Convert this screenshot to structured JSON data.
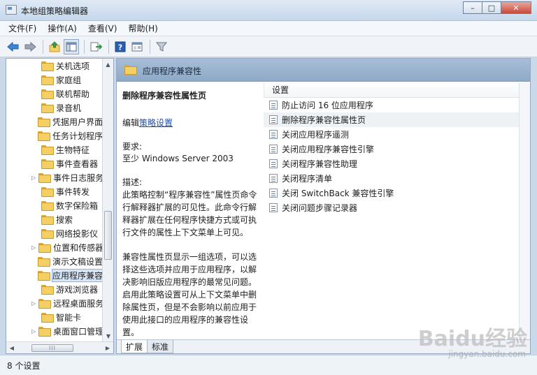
{
  "window": {
    "title": "本地组策略编辑器",
    "minimize": "–",
    "maximize": "□",
    "close": "✕"
  },
  "menu": {
    "file": "文件(F)",
    "action": "操作(A)",
    "view": "查看(V)",
    "help": "帮助(H)"
  },
  "toolbar": {
    "icons": [
      "back-arrow-icon",
      "forward-arrow-icon",
      "up-folder-icon",
      "show-hide-tree-icon",
      "export-list-icon",
      "help-icon",
      "extended-view-icon",
      "filter-icon"
    ]
  },
  "tree": {
    "items": [
      {
        "label": "关机选项",
        "expandable": false
      },
      {
        "label": "家庭组",
        "expandable": false
      },
      {
        "label": "联机帮助",
        "expandable": false
      },
      {
        "label": "录音机",
        "expandable": false
      },
      {
        "label": "凭据用户界面",
        "expandable": false
      },
      {
        "label": "任务计划程序",
        "expandable": false
      },
      {
        "label": "生物特征",
        "expandable": false
      },
      {
        "label": "事件查看器",
        "expandable": false
      },
      {
        "label": "事件日志服务",
        "expandable": true
      },
      {
        "label": "事件转发",
        "expandable": false
      },
      {
        "label": "数字保险箱",
        "expandable": false
      },
      {
        "label": "搜索",
        "expandable": false
      },
      {
        "label": "网络投影仪",
        "expandable": false
      },
      {
        "label": "位置和传感器",
        "expandable": true
      },
      {
        "label": "演示文稿设置",
        "expandable": false
      },
      {
        "label": "应用程序兼容",
        "expandable": false,
        "selected": true
      },
      {
        "label": "游戏浏览器",
        "expandable": false
      },
      {
        "label": "远程桌面服务",
        "expandable": true
      },
      {
        "label": "智能卡",
        "expandable": false
      },
      {
        "label": "桌面窗口管理",
        "expandable": true
      }
    ],
    "scroll_thumb_grip": "III"
  },
  "header": {
    "title": "应用程序兼容性"
  },
  "description": {
    "policy_title": "删除程序兼容性属性页",
    "edit_prefix": "编辑",
    "edit_link": "策略设置",
    "requirements_label": "要求:",
    "requirements_value": "至少 Windows Server 2003",
    "description_label": "描述:",
    "paragraph1": "此策略控制“程序兼容性”属性页命令行解释器扩展的可见性。此命令行解释器扩展在任何程序快捷方式或可执行文件的属性上下文菜单上可见。",
    "paragraph2": "兼容性属性页显示一组选项，可以选择这些选项并应用于应用程序，以解决影响旧版应用程序的最常见问题。启用此策略设置可从上下文菜单中删除属性页，但是不会影响以前应用于使用此接口的应用程序的兼容性设置。"
  },
  "settings": {
    "column_header": "设置",
    "items": [
      "防止访问 16 位应用程序",
      "删除程序兼容性属性页",
      "关闭应用程序遥测",
      "关闭应用程序兼容性引擎",
      "关闭程序兼容性助理",
      "关闭程序清单",
      "关闭 SwitchBack 兼容性引擎",
      "关闭问题步骤记录器"
    ],
    "highlighted_index": 1
  },
  "tabs": {
    "extended": "扩展",
    "standard": "标准"
  },
  "status": {
    "text": "8 个设置"
  },
  "watermark": {
    "main": "Baidu经验",
    "sub": "jingyan.baidu.com"
  }
}
